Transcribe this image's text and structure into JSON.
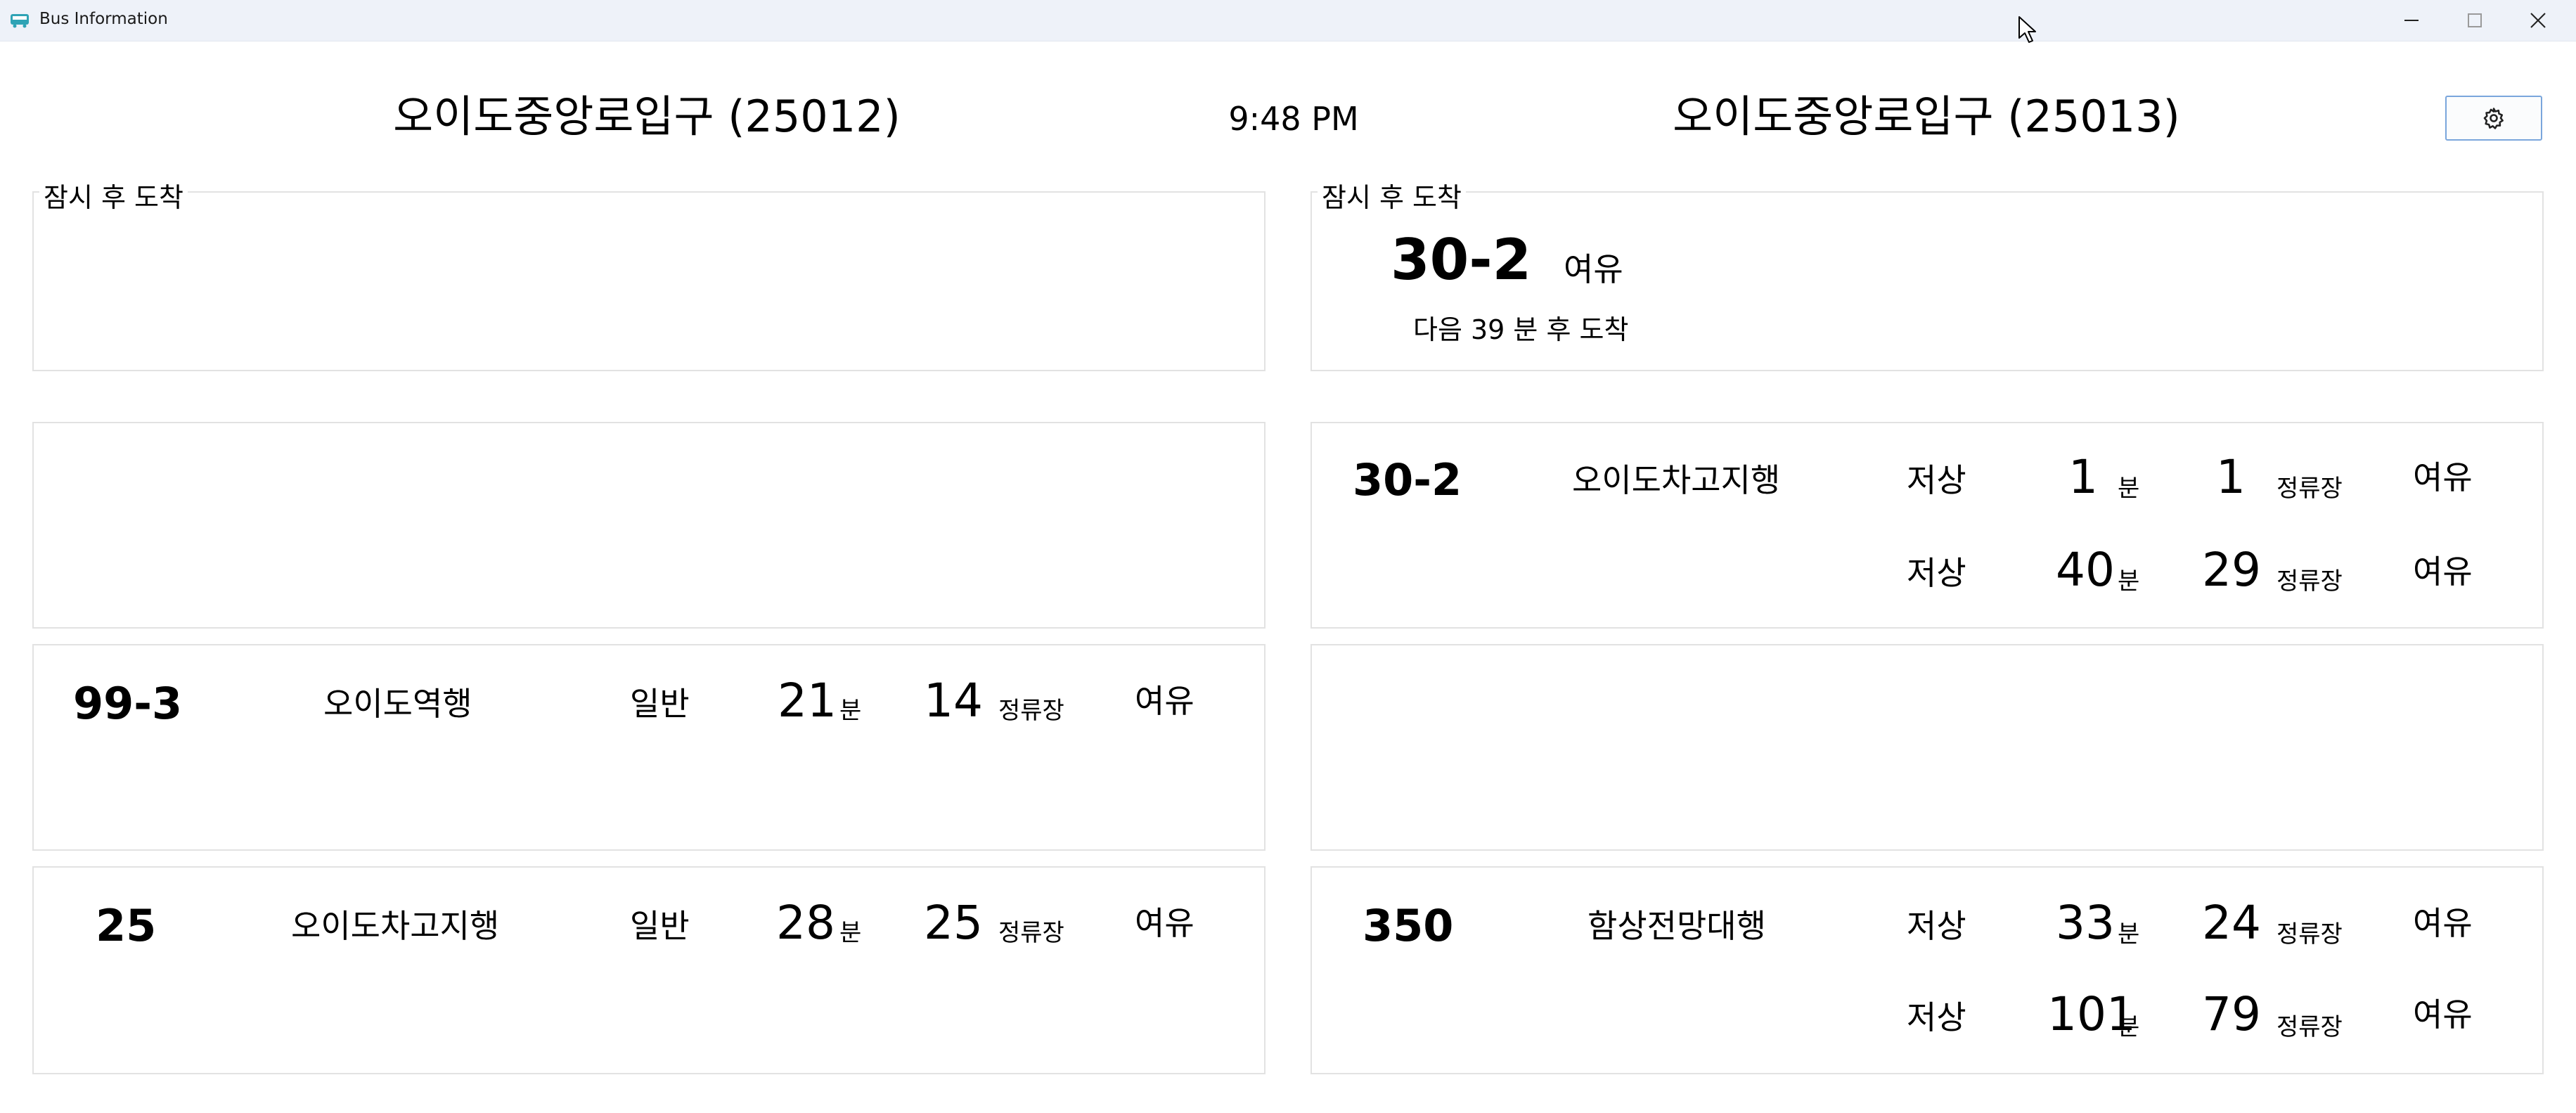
{
  "window": {
    "title": "Bus Information"
  },
  "header": {
    "left_stop_title": "오이도중앙로입구 (25012)",
    "clock": "9:48 PM",
    "right_stop_title": "오이도중앙로입구 (25013)"
  },
  "left": {
    "soon_label": "잠시 후 도착",
    "rows": [
      {
        "route": "99-3",
        "destination": "오이도역행",
        "bus_type": "일반",
        "minutes": "21",
        "minutes_unit": "분",
        "stops": "14",
        "stops_unit": "정류장",
        "crowding": "여유"
      },
      {
        "route": "25",
        "destination": "오이도차고지행",
        "bus_type": "일반",
        "minutes": "28",
        "minutes_unit": "분",
        "stops": "25",
        "stops_unit": "정류장",
        "crowding": "여유"
      }
    ]
  },
  "right": {
    "soon_label": "잠시 후 도착",
    "soon_route": "30-2",
    "soon_crowding": "여유",
    "soon_next": "다음 39 분 후 도착",
    "rows": [
      {
        "route": "30-2",
        "destination": "오이도차고지행",
        "arrivals": [
          {
            "bus_type": "저상",
            "minutes": "1",
            "minutes_unit": "분",
            "stops": "1",
            "stops_unit": "정류장",
            "crowding": "여유"
          },
          {
            "bus_type": "저상",
            "minutes": "40",
            "minutes_unit": "분",
            "stops": "29",
            "stops_unit": "정류장",
            "crowding": "여유"
          }
        ]
      },
      {
        "route": "350",
        "destination": "함상전망대행",
        "arrivals": [
          {
            "bus_type": "저상",
            "minutes": "33",
            "minutes_unit": "분",
            "stops": "24",
            "stops_unit": "정류장",
            "crowding": "여유"
          },
          {
            "bus_type": "저상",
            "minutes": "101",
            "minutes_unit": "분",
            "stops": "79",
            "stops_unit": "정류장",
            "crowding": "여유"
          }
        ]
      }
    ]
  },
  "icons": {
    "app": "bus-icon",
    "minimize": "minimize-icon",
    "maximize": "maximize-icon",
    "close": "close-icon",
    "settings": "gear-icon",
    "cursor": "mouse-cursor-icon"
  },
  "colors": {
    "titlebar_bg": "#eef2f9",
    "panel_border": "#e2e2e2",
    "settings_border": "#7aa6dc",
    "bus_icon": "#2fa3b5"
  }
}
